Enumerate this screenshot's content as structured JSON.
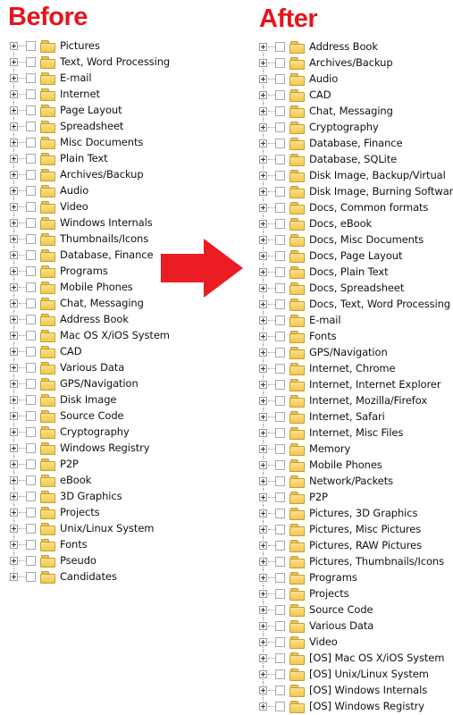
{
  "before": {
    "title": "Before",
    "items": [
      {
        "label": "Pictures"
      },
      {
        "label": "Text, Word Processing"
      },
      {
        "label": "E-mail"
      },
      {
        "label": "Internet"
      },
      {
        "label": "Page Layout"
      },
      {
        "label": "Spreadsheet"
      },
      {
        "label": "Misc Documents"
      },
      {
        "label": "Plain Text"
      },
      {
        "label": "Archives/Backup"
      },
      {
        "label": "Audio"
      },
      {
        "label": "Video"
      },
      {
        "label": "Windows Internals"
      },
      {
        "label": "Thumbnails/Icons"
      },
      {
        "label": "Database, Finance"
      },
      {
        "label": "Programs"
      },
      {
        "label": "Mobile Phones"
      },
      {
        "label": "Chat, Messaging"
      },
      {
        "label": "Address Book"
      },
      {
        "label": "Mac OS X/iOS System"
      },
      {
        "label": "CAD"
      },
      {
        "label": "Various Data"
      },
      {
        "label": "GPS/Navigation"
      },
      {
        "label": "Disk Image"
      },
      {
        "label": "Source Code"
      },
      {
        "label": "Cryptography"
      },
      {
        "label": "Windows Registry"
      },
      {
        "label": "P2P"
      },
      {
        "label": "eBook"
      },
      {
        "label": "3D Graphics"
      },
      {
        "label": "Projects"
      },
      {
        "label": "Unix/Linux System"
      },
      {
        "label": "Fonts"
      },
      {
        "label": "Pseudo"
      },
      {
        "label": "Candidates"
      }
    ]
  },
  "after": {
    "title": "After",
    "items": [
      {
        "label": "Address Book"
      },
      {
        "label": "Archives/Backup"
      },
      {
        "label": "Audio"
      },
      {
        "label": "CAD"
      },
      {
        "label": "Chat, Messaging"
      },
      {
        "label": "Cryptography"
      },
      {
        "label": "Database, Finance"
      },
      {
        "label": "Database, SQLite"
      },
      {
        "label": "Disk Image, Backup/Virtual"
      },
      {
        "label": "Disk Image, Burning Software"
      },
      {
        "label": "Docs, Common formats"
      },
      {
        "label": "Docs, eBook"
      },
      {
        "label": "Docs, Misc Documents"
      },
      {
        "label": "Docs, Page Layout"
      },
      {
        "label": "Docs, Plain Text"
      },
      {
        "label": "Docs, Spreadsheet"
      },
      {
        "label": "Docs, Text, Word Processing"
      },
      {
        "label": "E-mail"
      },
      {
        "label": "Fonts"
      },
      {
        "label": "GPS/Navigation"
      },
      {
        "label": "Internet, Chrome"
      },
      {
        "label": "Internet, Internet Explorer"
      },
      {
        "label": "Internet, Mozilla/Firefox"
      },
      {
        "label": "Internet, Safari"
      },
      {
        "label": "Internet, Misc Files"
      },
      {
        "label": "Memory"
      },
      {
        "label": "Mobile Phones"
      },
      {
        "label": "Network/Packets"
      },
      {
        "label": "P2P"
      },
      {
        "label": "Pictures, 3D Graphics"
      },
      {
        "label": "Pictures, Misc Pictures"
      },
      {
        "label": "Pictures, RAW Pictures"
      },
      {
        "label": "Pictures, Thumbnails/Icons"
      },
      {
        "label": "Programs"
      },
      {
        "label": "Projects"
      },
      {
        "label": "Source Code"
      },
      {
        "label": "Various Data"
      },
      {
        "label": "Video"
      },
      {
        "label": "[OS] Mac OS X/iOS System"
      },
      {
        "label": "[OS] Unix/Linux System"
      },
      {
        "label": "[OS] Windows Internals"
      },
      {
        "label": "[OS] Windows Registry"
      }
    ]
  },
  "colors": {
    "heading": "#e8141b",
    "arrow": "#ec1c24",
    "folder": "#f2c84e"
  },
  "icons": {
    "expander": "plus-box-icon",
    "checkbox": "checkbox-icon",
    "folder": "folder-icon",
    "arrow": "right-arrow-icon"
  }
}
